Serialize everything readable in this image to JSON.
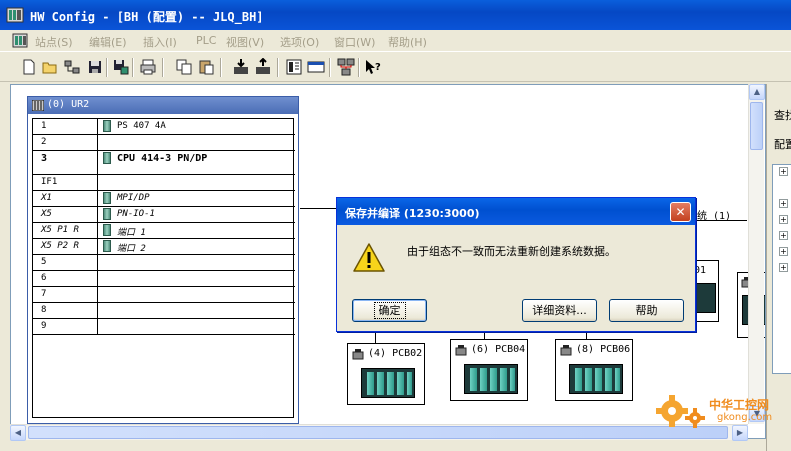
{
  "window": {
    "title": "HW Config - [BH (配置) -- JLQ_BH]"
  },
  "menu": [
    {
      "label": "站点(S)"
    },
    {
      "label": "编辑(E)"
    },
    {
      "label": "插入(I)"
    },
    {
      "label": "PLC"
    },
    {
      "label": "视图(V)"
    },
    {
      "label": "选项(O)"
    },
    {
      "label": "窗口(W)"
    },
    {
      "label": "帮助(H)"
    }
  ],
  "toolbar": {
    "icons": [
      "new-icon",
      "open-icon",
      "network-access-icon",
      "save-icon",
      "save-compile-icon",
      "print-icon",
      "copy-icon",
      "paste-icon",
      "download-icon",
      "upload-icon",
      "catalog-icon",
      "overview-icon",
      "network-config-icon",
      "help-pointer-icon"
    ]
  },
  "rack": {
    "title": "(0) UR2",
    "rows": [
      {
        "slot": "1",
        "module": "PS 407 4A",
        "style": "normal"
      },
      {
        "slot": "2",
        "module": "",
        "style": "normal"
      },
      {
        "slot": "3",
        "module": "CPU 414-3 PN/DP",
        "style": "bold"
      },
      {
        "slot": "IF1",
        "module": "",
        "style": "normal"
      },
      {
        "slot": "X1",
        "module": "MPI/DP",
        "style": "italic"
      },
      {
        "slot": "X5",
        "module": "PN-IO-1",
        "style": "italic"
      },
      {
        "slot": "X5 P1 R",
        "module": "端口 1",
        "style": "italic"
      },
      {
        "slot": "X5 P2 R",
        "module": "端口 2",
        "style": "italic"
      },
      {
        "slot": "5",
        "module": "",
        "style": "normal"
      },
      {
        "slot": "6",
        "module": "",
        "style": "normal"
      },
      {
        "slot": "7",
        "module": "",
        "style": "normal"
      },
      {
        "slot": "8",
        "module": "",
        "style": "normal"
      },
      {
        "slot": "9",
        "module": "",
        "style": "normal"
      }
    ]
  },
  "network": {
    "system_label": "统 (1)",
    "partial_label": "01",
    "stations": [
      {
        "label": "(4) PCB02"
      },
      {
        "label": "(6) PCB04"
      },
      {
        "label": "(8) PCB06"
      }
    ]
  },
  "right_panel": {
    "find_label": "查找",
    "profile_label": "配置"
  },
  "dialog": {
    "title": "保存并编译 (1230:3000)",
    "message": "由于组态不一致而无法重新创建系统数据。",
    "ok_label": "确定",
    "details_label": "详细资料...",
    "help_label": "帮助",
    "close_symbol": "✕"
  },
  "watermark": {
    "title": "中华工控网",
    "url": "gkong.com"
  }
}
